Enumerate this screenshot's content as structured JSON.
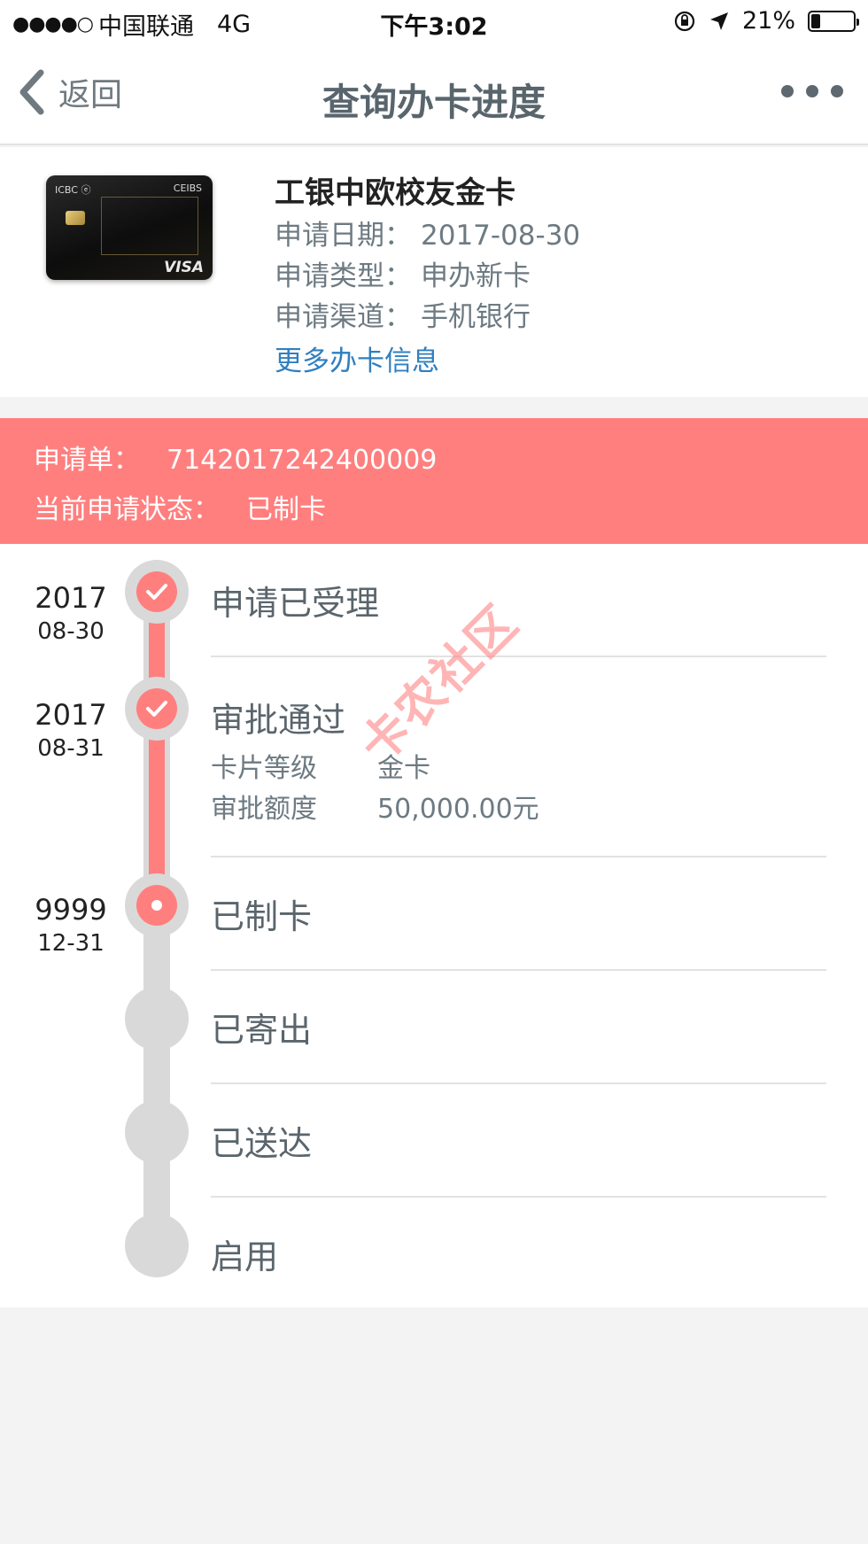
{
  "status_bar": {
    "signal": "●●●●○",
    "carrier": "中国联通",
    "network": "4G",
    "time": "下午3:02",
    "battery_text": "21%",
    "battery_level": 0.21
  },
  "nav": {
    "back_label": "返回",
    "title": "查询办卡进度"
  },
  "card": {
    "image_texts": {
      "brand_left": "ICBC ⓔ",
      "brand_right": "CEIBS",
      "network": "VISA"
    },
    "name": "工银中欧校友金卡",
    "apply_date_label": "申请日期：",
    "apply_date": "2017-08-30",
    "apply_type_label": "申请类型：",
    "apply_type": "申办新卡",
    "apply_channel_label": "申请渠道：",
    "apply_channel": "手机银行",
    "more_info_link": "更多办卡信息"
  },
  "banner": {
    "order_label": "申请单：",
    "order_no": "7142017242400009",
    "status_label": "当前申请状态：",
    "status_value": "已制卡"
  },
  "timeline": [
    {
      "year": "2017",
      "md": "08-30",
      "label": "申请已受理",
      "state": "done"
    },
    {
      "year": "2017",
      "md": "08-31",
      "label": "审批通过",
      "state": "done",
      "details": [
        {
          "k": "卡片等级",
          "v": "金卡"
        },
        {
          "k": "审批额度",
          "v": "50,000.00元"
        }
      ]
    },
    {
      "year": "9999",
      "md": "12-31",
      "label": "已制卡",
      "state": "current"
    },
    {
      "label": "已寄出",
      "state": "pending"
    },
    {
      "label": "已送达",
      "state": "pending"
    },
    {
      "label": "启用",
      "state": "pending"
    }
  ],
  "watermark": "卡农社区",
  "colors": {
    "accent": "#ff7f7f",
    "link": "#2f7fc0",
    "track": "#d9d9d9"
  },
  "icons": {
    "done": "check-icon",
    "current": "dot-icon",
    "back": "chevron-left-icon",
    "more": "more-dots-icon"
  }
}
